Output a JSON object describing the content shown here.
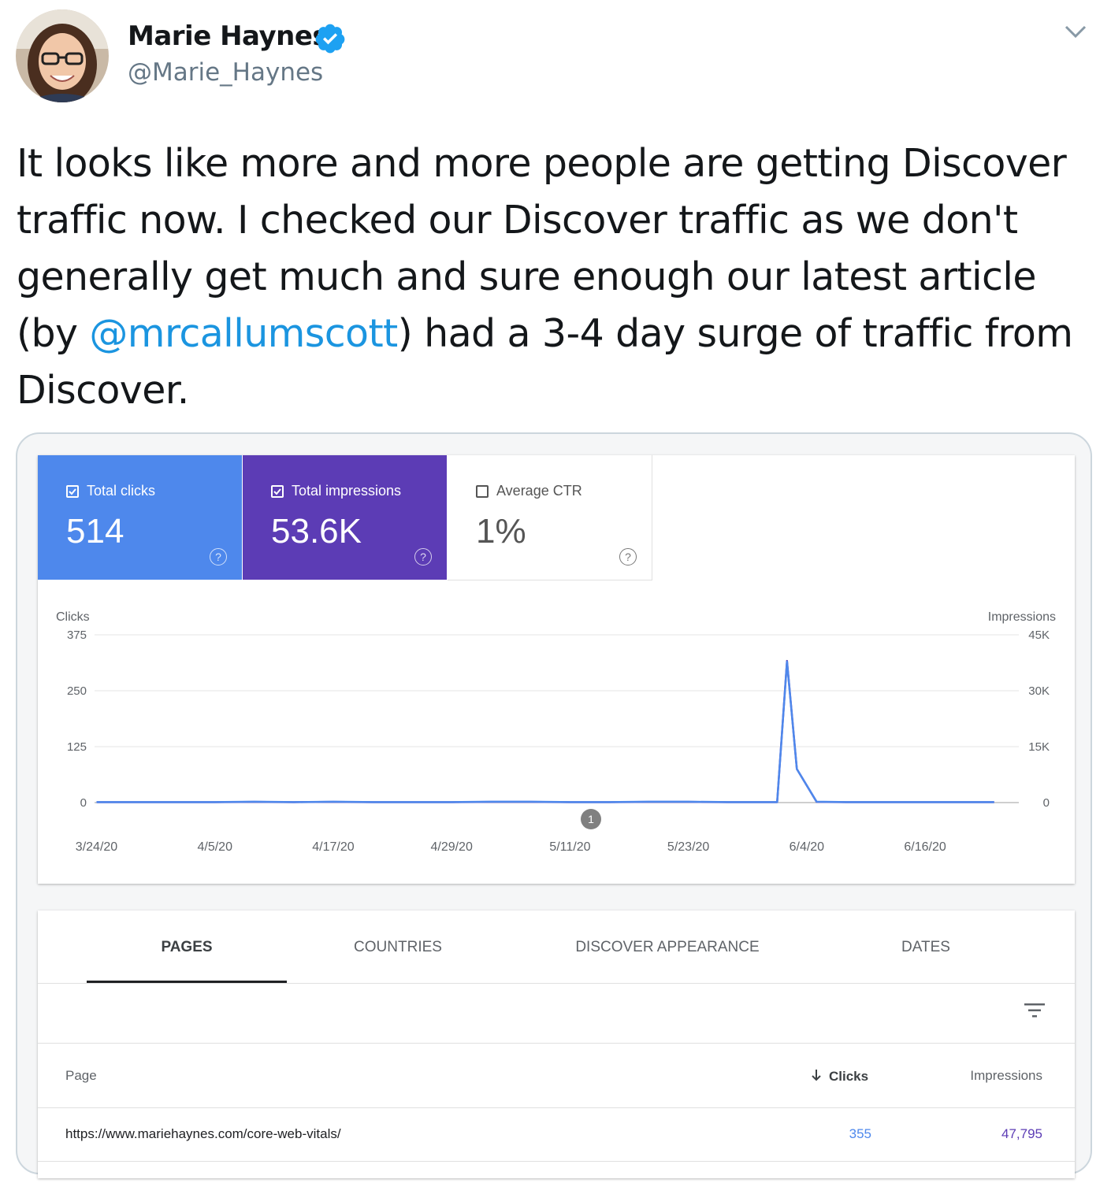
{
  "tweet": {
    "author_name": "Marie Haynes",
    "handle": "@Marie_Haynes",
    "text_before": "It looks like more and more people are getting Discover traffic now. I checked our Discover traffic as we don't generally get much and sure enough our latest article (by ",
    "mention": "@mrcallumscott",
    "text_after": ") had a 3-4 day surge of traffic from Discover.",
    "colors": {
      "mention": "#1b95e0",
      "verified": "#1da1f2"
    },
    "icons": [
      "verified-badge-icon",
      "chevron-down-icon"
    ]
  },
  "search_console": {
    "metrics": [
      {
        "label": "Total clicks",
        "value": "514",
        "checked": true,
        "color": "#4e88ec"
      },
      {
        "label": "Total impressions",
        "value": "53.6K",
        "checked": true,
        "color": "#5c3cb5"
      },
      {
        "label": "Average CTR",
        "value": "1%",
        "checked": false,
        "color": "#ffffff"
      }
    ],
    "tabs": [
      "PAGES",
      "COUNTRIES",
      "DISCOVER APPEARANCE",
      "DATES"
    ],
    "active_tab": "PAGES",
    "annotation_marker": "1",
    "table": {
      "headers": {
        "page": "Page",
        "clicks": "Clicks",
        "impressions": "Impressions"
      },
      "sort_indicator": "arrow-down-icon",
      "rows": [
        {
          "page": "https://www.mariehaynes.com/core-web-vitals/",
          "clicks": "355",
          "impressions": "47,795"
        }
      ],
      "colors": {
        "clicks": "#4e88ec",
        "impressions": "#5c3cb5"
      }
    }
  },
  "chart_data": {
    "type": "line",
    "ylabel": "Clicks",
    "y2label": "Impressions",
    "ylim": [
      0,
      375
    ],
    "y_ticks": [
      "375",
      "250",
      "125",
      "0"
    ],
    "y2lim": [
      0,
      45000
    ],
    "y2_ticks": [
      "45K",
      "30K",
      "15K",
      "0"
    ],
    "x_tick_labels": [
      "3/24/20",
      "4/5/20",
      "4/17/20",
      "4/29/20",
      "5/11/20",
      "5/23/20",
      "6/4/20",
      "6/16/20"
    ],
    "grid": true,
    "series": [
      {
        "name": "Clicks",
        "color": "#4e88ec",
        "x": [
          "3/24/20",
          "3/28/20",
          "4/1/20",
          "4/5/20",
          "4/9/20",
          "4/13/20",
          "4/17/20",
          "4/21/20",
          "4/25/20",
          "4/29/20",
          "5/3/20",
          "5/7/20",
          "5/11/20",
          "5/15/20",
          "5/19/20",
          "5/23/20",
          "5/27/20",
          "5/31/20",
          "6/1/20",
          "6/2/20",
          "6/3/20",
          "6/5/20",
          "6/8/20",
          "6/12/20",
          "6/16/20",
          "6/20/20",
          "6/23/20"
        ],
        "values": [
          1,
          1,
          1,
          1,
          2,
          1,
          2,
          1,
          1,
          1,
          2,
          2,
          1,
          1,
          2,
          2,
          1,
          1,
          1,
          315,
          75,
          2,
          1,
          1,
          1,
          1,
          1
        ]
      },
      {
        "name": "Impressions",
        "color": "#5c3cb5",
        "x": [
          "3/24/20",
          "3/28/20",
          "4/1/20",
          "4/5/20",
          "4/9/20",
          "4/13/20",
          "4/17/20",
          "4/21/20",
          "4/25/20",
          "4/29/20",
          "5/3/20",
          "5/7/20",
          "5/11/20",
          "5/15/20",
          "5/19/20",
          "5/23/20",
          "5/27/20",
          "5/31/20",
          "6/1/20",
          "6/2/20",
          "6/3/20",
          "6/5/20",
          "6/8/20",
          "6/12/20",
          "6/16/20",
          "6/20/20",
          "6/23/20"
        ],
        "values": [
          100,
          100,
          100,
          100,
          200,
          100,
          200,
          100,
          100,
          100,
          200,
          200,
          100,
          100,
          200,
          200,
          100,
          100,
          100,
          38000,
          9000,
          200,
          100,
          100,
          100,
          100,
          100
        ]
      }
    ]
  }
}
